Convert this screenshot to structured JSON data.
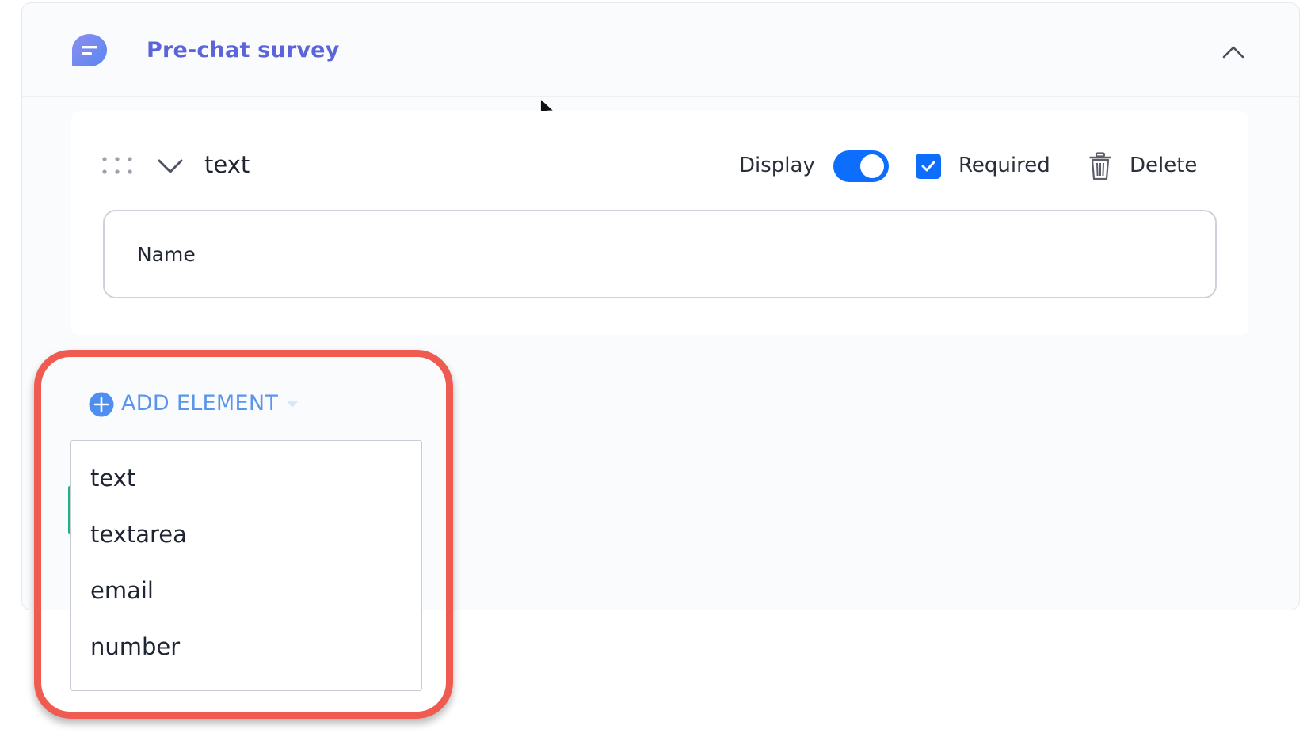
{
  "panel": {
    "title": "Pre-chat survey",
    "colors": {
      "title": "#5b64d9",
      "icon_gradient_start": "#8c8ff0",
      "icon_gradient_end": "#5a86f0",
      "accent": "#0d6efd",
      "highlight": "#ef5b50",
      "add_link": "#5b95ea"
    },
    "icons": {
      "survey": "chat-bubble-icon",
      "collapse": "chevron-up-icon"
    }
  },
  "field": {
    "type": "text",
    "display_label": "Display",
    "display_on": true,
    "required_label": "Required",
    "required_checked": true,
    "delete_label": "Delete",
    "input_value": "Name",
    "icons": {
      "drag": "drag-handle-icon",
      "expand": "chevron-down-icon",
      "delete": "trash-icon"
    }
  },
  "add_element": {
    "label": "ADD ELEMENT",
    "options": [
      "text",
      "textarea",
      "email",
      "number"
    ]
  }
}
